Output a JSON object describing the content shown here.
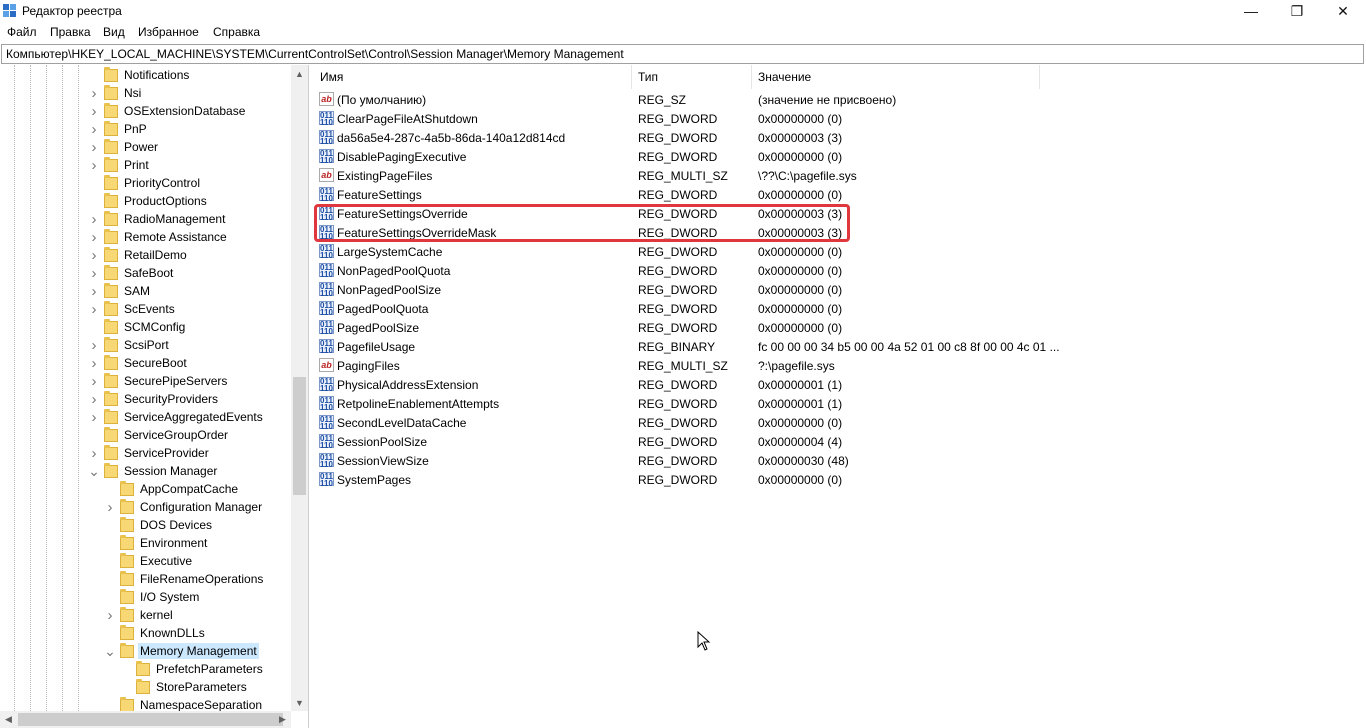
{
  "window": {
    "title": "Редактор реестра",
    "minimize_glyph": "—",
    "maximize_glyph": "❐",
    "close_glyph": "✕"
  },
  "menu": [
    "Файл",
    "Правка",
    "Вид",
    "Избранное",
    "Справка"
  ],
  "address": "Компьютер\\HKEY_LOCAL_MACHINE\\SYSTEM\\CurrentControlSet\\Control\\Session Manager\\Memory Management",
  "tree": {
    "items": [
      {
        "label": "Notifications",
        "level": 0,
        "expander": "none"
      },
      {
        "label": "Nsi",
        "level": 0,
        "expander": "collapsed"
      },
      {
        "label": "OSExtensionDatabase",
        "level": 0,
        "expander": "collapsed"
      },
      {
        "label": "PnP",
        "level": 0,
        "expander": "collapsed"
      },
      {
        "label": "Power",
        "level": 0,
        "expander": "collapsed"
      },
      {
        "label": "Print",
        "level": 0,
        "expander": "collapsed"
      },
      {
        "label": "PriorityControl",
        "level": 0,
        "expander": "none"
      },
      {
        "label": "ProductOptions",
        "level": 0,
        "expander": "none"
      },
      {
        "label": "RadioManagement",
        "level": 0,
        "expander": "collapsed"
      },
      {
        "label": "Remote Assistance",
        "level": 0,
        "expander": "collapsed"
      },
      {
        "label": "RetailDemo",
        "level": 0,
        "expander": "collapsed"
      },
      {
        "label": "SafeBoot",
        "level": 0,
        "expander": "collapsed"
      },
      {
        "label": "SAM",
        "level": 0,
        "expander": "collapsed"
      },
      {
        "label": "ScEvents",
        "level": 0,
        "expander": "collapsed"
      },
      {
        "label": "SCMConfig",
        "level": 0,
        "expander": "none"
      },
      {
        "label": "ScsiPort",
        "level": 0,
        "expander": "collapsed"
      },
      {
        "label": "SecureBoot",
        "level": 0,
        "expander": "collapsed"
      },
      {
        "label": "SecurePipeServers",
        "level": 0,
        "expander": "collapsed"
      },
      {
        "label": "SecurityProviders",
        "level": 0,
        "expander": "collapsed"
      },
      {
        "label": "ServiceAggregatedEvents",
        "level": 0,
        "expander": "collapsed"
      },
      {
        "label": "ServiceGroupOrder",
        "level": 0,
        "expander": "none"
      },
      {
        "label": "ServiceProvider",
        "level": 0,
        "expander": "collapsed"
      },
      {
        "label": "Session Manager",
        "level": 0,
        "expander": "expanded"
      },
      {
        "label": "AppCompatCache",
        "level": 1,
        "expander": "none"
      },
      {
        "label": "Configuration Manager",
        "level": 1,
        "expander": "collapsed"
      },
      {
        "label": "DOS Devices",
        "level": 1,
        "expander": "none"
      },
      {
        "label": "Environment",
        "level": 1,
        "expander": "none"
      },
      {
        "label": "Executive",
        "level": 1,
        "expander": "none"
      },
      {
        "label": "FileRenameOperations",
        "level": 1,
        "expander": "none"
      },
      {
        "label": "I/O System",
        "level": 1,
        "expander": "none"
      },
      {
        "label": "kernel",
        "level": 1,
        "expander": "collapsed"
      },
      {
        "label": "KnownDLLs",
        "level": 1,
        "expander": "none"
      },
      {
        "label": "Memory Management",
        "level": 1,
        "expander": "expanded",
        "selected": true
      },
      {
        "label": "PrefetchParameters",
        "level": 2,
        "expander": "none"
      },
      {
        "label": "StoreParameters",
        "level": 2,
        "expander": "none"
      },
      {
        "label": "NamespaceSeparation",
        "level": 1,
        "expander": "none"
      }
    ]
  },
  "columns": {
    "name": "Имя",
    "type": "Тип",
    "data": "Значение"
  },
  "values": [
    {
      "icon": "sz",
      "name": "(По умолчанию)",
      "type": "REG_SZ",
      "data": "(значение не присвоено)"
    },
    {
      "icon": "bin",
      "name": "ClearPageFileAtShutdown",
      "type": "REG_DWORD",
      "data": "0x00000000 (0)"
    },
    {
      "icon": "bin",
      "name": "da56a5e4-287c-4a5b-86da-140a12d814cd",
      "type": "REG_DWORD",
      "data": "0x00000003 (3)"
    },
    {
      "icon": "bin",
      "name": "DisablePagingExecutive",
      "type": "REG_DWORD",
      "data": "0x00000000 (0)"
    },
    {
      "icon": "sz",
      "name": "ExistingPageFiles",
      "type": "REG_MULTI_SZ",
      "data": "\\??\\C:\\pagefile.sys"
    },
    {
      "icon": "bin",
      "name": "FeatureSettings",
      "type": "REG_DWORD",
      "data": "0x00000000 (0)"
    },
    {
      "icon": "bin",
      "name": "FeatureSettingsOverride",
      "type": "REG_DWORD",
      "data": "0x00000003 (3)"
    },
    {
      "icon": "bin",
      "name": "FeatureSettingsOverrideMask",
      "type": "REG_DWORD",
      "data": "0x00000003 (3)"
    },
    {
      "icon": "bin",
      "name": "LargeSystemCache",
      "type": "REG_DWORD",
      "data": "0x00000000 (0)"
    },
    {
      "icon": "bin",
      "name": "NonPagedPoolQuota",
      "type": "REG_DWORD",
      "data": "0x00000000 (0)"
    },
    {
      "icon": "bin",
      "name": "NonPagedPoolSize",
      "type": "REG_DWORD",
      "data": "0x00000000 (0)"
    },
    {
      "icon": "bin",
      "name": "PagedPoolQuota",
      "type": "REG_DWORD",
      "data": "0x00000000 (0)"
    },
    {
      "icon": "bin",
      "name": "PagedPoolSize",
      "type": "REG_DWORD",
      "data": "0x00000000 (0)"
    },
    {
      "icon": "bin",
      "name": "PagefileUsage",
      "type": "REG_BINARY",
      "data": "fc 00 00 00 34 b5 00 00 4a 52 01 00 c8 8f 00 00 4c 01 ..."
    },
    {
      "icon": "sz",
      "name": "PagingFiles",
      "type": "REG_MULTI_SZ",
      "data": "?:\\pagefile.sys"
    },
    {
      "icon": "bin",
      "name": "PhysicalAddressExtension",
      "type": "REG_DWORD",
      "data": "0x00000001 (1)"
    },
    {
      "icon": "bin",
      "name": "RetpolineEnablementAttempts",
      "type": "REG_DWORD",
      "data": "0x00000001 (1)"
    },
    {
      "icon": "bin",
      "name": "SecondLevelDataCache",
      "type": "REG_DWORD",
      "data": "0x00000000 (0)"
    },
    {
      "icon": "bin",
      "name": "SessionPoolSize",
      "type": "REG_DWORD",
      "data": "0x00000004 (4)"
    },
    {
      "icon": "bin",
      "name": "SessionViewSize",
      "type": "REG_DWORD",
      "data": "0x00000030 (48)"
    },
    {
      "icon": "bin",
      "name": "SystemPages",
      "type": "REG_DWORD",
      "data": "0x00000000 (0)"
    }
  ],
  "icon_glyphs": {
    "sz": "ab",
    "bin": "011\n110"
  },
  "colors": {
    "highlight": "#e0363e",
    "selection": "#cce8ff",
    "folder": "#f8d775"
  }
}
